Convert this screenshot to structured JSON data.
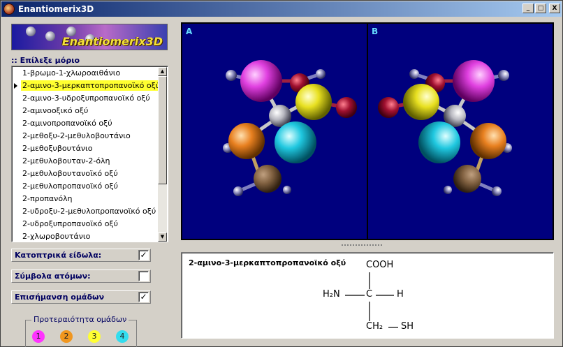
{
  "window": {
    "title": "Enantiomerix3D",
    "controls": [
      "_",
      "□",
      "X"
    ]
  },
  "logo": {
    "text": "Enantiomerix3D"
  },
  "molecule_list": {
    "label": ":: Επίλεξε μόριο",
    "items": [
      "1-βρωμο-1-χλωροαιθάνιο",
      "2-αμινο-3-μερκαπτοπροπανοϊκό οξύ",
      "2-αμινο-3-υδροξυπροπανοϊκό οξύ",
      "2-αμινοοξικό οξύ",
      "2-αμινοπροπανοϊκό οξύ",
      "2-μεθοξυ-2-μεθυλοβουτάνιο",
      "2-μεθοξυβουτάνιο",
      "2-μεθυλοβουταν-2-όλη",
      "2-μεθυλοβουτανοϊκό οξύ",
      "2-μεθυλοπροπανοϊκό οξύ",
      "2-προπανόλη",
      "2-υδροξυ-2-μεθυλοπροπανοϊκό οξύ",
      "2-υδροξυπροπανοϊκό οξύ",
      "2-χλωροβουτάνιο"
    ],
    "selected_index": 1
  },
  "options": {
    "mirror_images": {
      "label": "Κατοπτρικά είδωλα:",
      "checked": true,
      "mark": "✓"
    },
    "atom_symbols": {
      "label": "Σύμβολα ατόμων:",
      "checked": false,
      "mark": ""
    },
    "highlight_groups": {
      "label": "Επισήμανση ομάδων",
      "checked": true,
      "mark": "✓"
    }
  },
  "priority": {
    "title": "Προτεραιότητα ομάδων",
    "items": [
      {
        "label": "1",
        "color": "#ff33ff"
      },
      {
        "label": "2",
        "color": "#f0961e"
      },
      {
        "label": "3",
        "color": "#ffff33"
      },
      {
        "label": "4",
        "color": "#33ddee"
      }
    ]
  },
  "viewer": {
    "pane_a_label": "A",
    "pane_b_label": "B",
    "background": "#00007e"
  },
  "formula": {
    "name": "2-αμινο-3-μερκαπτοπροπανοϊκό οξύ",
    "top_group": "COOH",
    "left_group": "H₂N",
    "center": "C",
    "right_group": "H",
    "bottom_group": "CH₂",
    "bottom_tail": "SH"
  }
}
